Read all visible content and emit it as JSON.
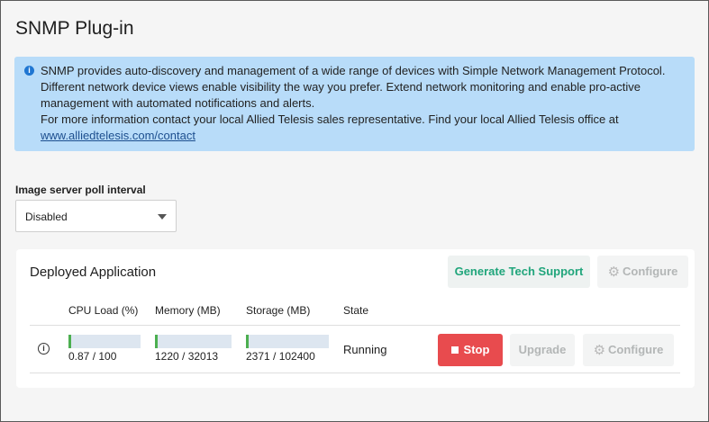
{
  "page": {
    "title": "SNMP Plug-in"
  },
  "info": {
    "line1": "SNMP provides auto-discovery and management of a wide range of devices with Simple Network Management Protocol.",
    "line2": "Different network device views enable visibility the way you prefer. Extend network monitoring and enable pro-active",
    "line3": "management with automated notifications and alerts.",
    "line4": "For more information contact your local Allied Telesis sales representative. Find your local Allied Telesis office at",
    "link": "www.alliedtelesis.com/contact"
  },
  "poll": {
    "label": "Image server poll interval",
    "selected": "Disabled"
  },
  "deployed": {
    "title": "Deployed Application",
    "generate_label": "Generate Tech Support",
    "configure_label": "Configure",
    "columns": {
      "cpu": "CPU Load (%)",
      "memory": "Memory (MB)",
      "storage": "Storage (MB)",
      "state": "State"
    },
    "row": {
      "cpu": {
        "text": "0.87 / 100",
        "fraction": 0.0087
      },
      "memory": {
        "text": "1220 / 32013",
        "fraction": 0.0381
      },
      "storage": {
        "text": "2371 / 102400",
        "fraction": 0.0232
      },
      "state": "Running",
      "stop_label": "Stop",
      "upgrade_label": "Upgrade",
      "configure_label": "Configure"
    }
  },
  "colors": {
    "accent_green": "#20a57b",
    "stop_red": "#e84b4e",
    "info_bg": "#b8dcf9",
    "bar_green": "#4caf50"
  }
}
